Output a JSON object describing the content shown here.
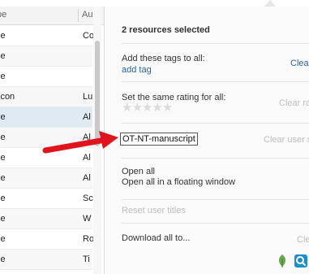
{
  "table": {
    "headers": [
      "pe",
      "Au"
    ],
    "rows": [
      {
        "type": "le",
        "author": "Co"
      },
      {
        "type": "le",
        "author": ""
      },
      {
        "type": "le",
        "author": ""
      },
      {
        "type": "icon",
        "author": "Lu"
      },
      {
        "type": "le",
        "author": "Al",
        "selected": true
      },
      {
        "type": "le",
        "author": "Al"
      },
      {
        "type": "le",
        "author": "Al"
      },
      {
        "type": "le",
        "author": "Al"
      },
      {
        "type": "le",
        "author": "Sc"
      },
      {
        "type": "le",
        "author": "W"
      },
      {
        "type": "le",
        "author": "Ro"
      },
      {
        "type": "le",
        "author": "Ti"
      }
    ]
  },
  "panel": {
    "selection_title": "2 resources selected",
    "tags_label": "Add these tags to all:",
    "add_tag_link": "add tag",
    "clear_tags": "Clear",
    "rating_label": "Set the same rating for all:",
    "clear_rating": "Clear ra",
    "star_count": 5,
    "title_value": "OT-NT-manuscript",
    "clear_user": "Clear user s",
    "open_all": "Open all",
    "open_floating": "Open all in a floating window",
    "reset_titles": "Reset user titles",
    "download_all": "Download all to...",
    "download_right": "Cle"
  },
  "icons": {
    "leaf": "evernote-leaf-icon",
    "search": "search-icon",
    "pointer": "red-arrow-annotation"
  },
  "colors": {
    "link": "#2266aa",
    "arrow": "#e0141c",
    "selected_row": "#dfeaf3",
    "leaf": "#6aa84f",
    "search": "#1b8fc9"
  }
}
